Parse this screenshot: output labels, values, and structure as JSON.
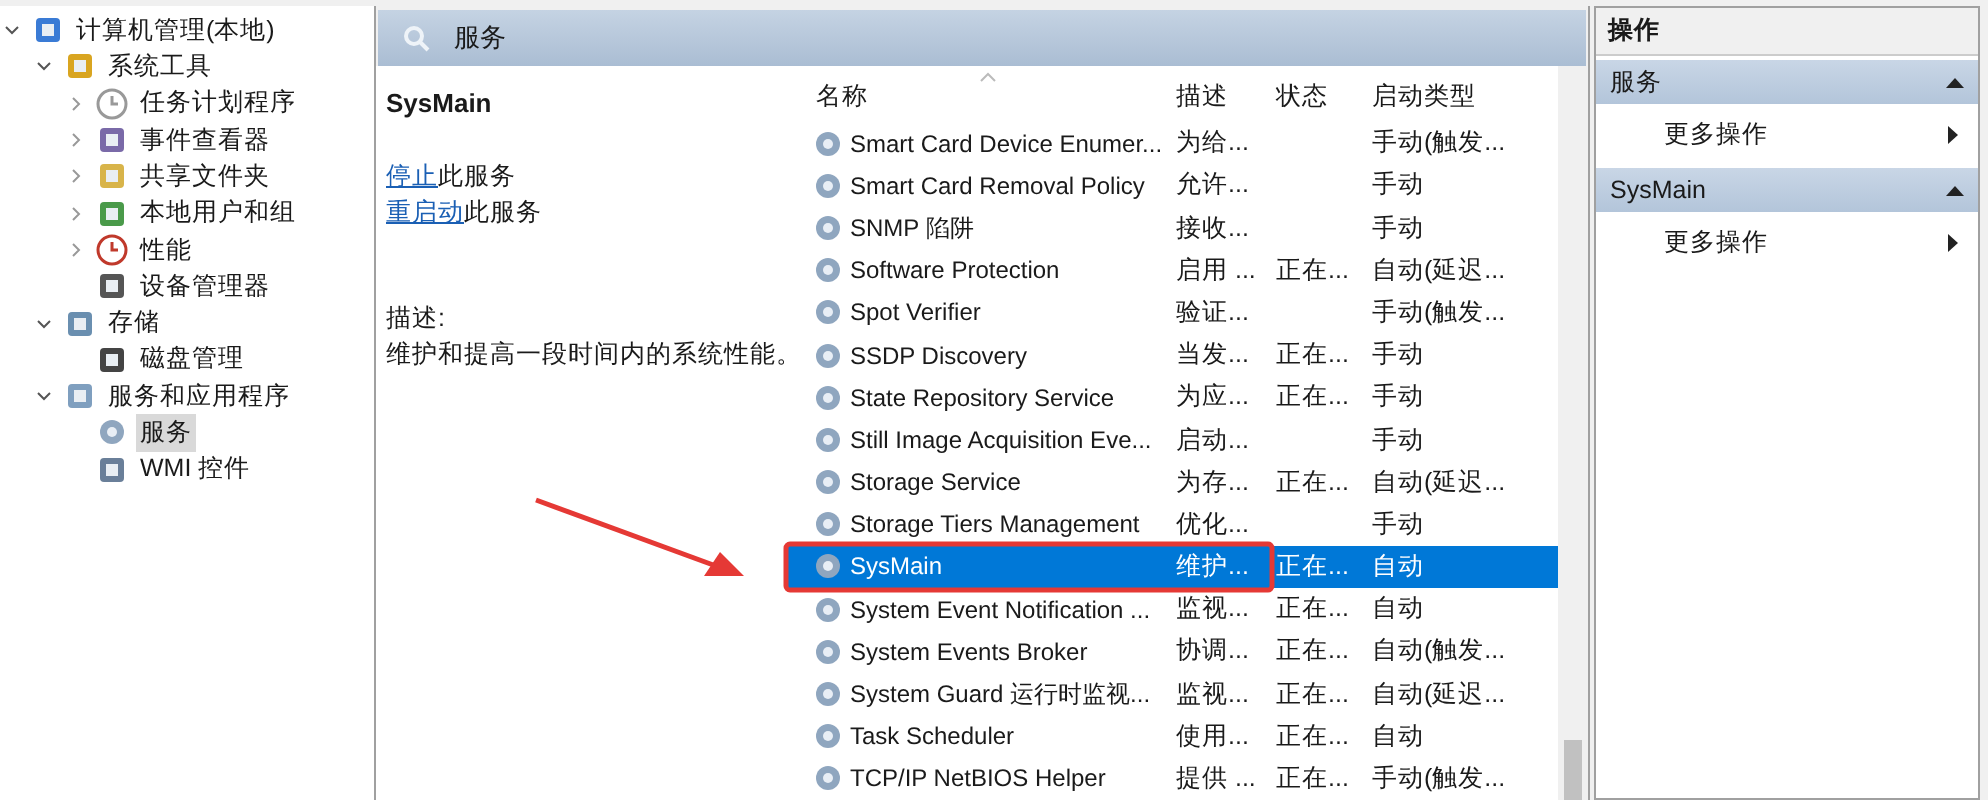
{
  "tree": [
    {
      "label": "计算机管理(本地)",
      "selected": false,
      "expanded": true,
      "children": [
        {
          "label": "系统工具",
          "selected": false,
          "expanded": true,
          "children": [
            {
              "label": "任务计划程序",
              "selected": false,
              "expanded": false
            },
            {
              "label": "事件查看器",
              "selected": false,
              "expanded": false
            },
            {
              "label": "共享文件夹",
              "selected": false,
              "expanded": false
            },
            {
              "label": "本地用户和组",
              "selected": false,
              "expanded": false
            },
            {
              "label": "性能",
              "selected": false,
              "expanded": false
            },
            {
              "label": "设备管理器",
              "selected": false
            }
          ]
        },
        {
          "label": "存储",
          "selected": false,
          "expanded": true,
          "children": [
            {
              "label": "磁盘管理",
              "selected": false
            }
          ]
        },
        {
          "label": "服务和应用程序",
          "selected": false,
          "expanded": true,
          "children": [
            {
              "label": "服务",
              "selected": true
            },
            {
              "label": "WMI 控件",
              "selected": false
            }
          ]
        }
      ]
    }
  ],
  "panel_title": "服务",
  "detail": {
    "service_name": "SysMain",
    "actions": [
      {
        "link": "停止",
        "text": "此服务"
      },
      {
        "link": "重启动",
        "text": "此服务"
      }
    ],
    "description_label": "描述:",
    "description": "维护和提高一段时间内的系统性能。"
  },
  "table": {
    "columns": [
      "名称",
      "描述",
      "状态",
      "启动类型"
    ],
    "rows": [
      {
        "name": "Smart Card Device Enumer...",
        "description": "为给...",
        "status": "",
        "startup": "手动(触发...",
        "selected": false
      },
      {
        "name": "Smart Card Removal Policy",
        "description": "允许...",
        "status": "",
        "startup": "手动",
        "selected": false
      },
      {
        "name": "SNMP 陷阱",
        "description": "接收...",
        "status": "",
        "startup": "手动",
        "selected": false
      },
      {
        "name": "Software Protection",
        "description": "启用 ...",
        "status": "正在...",
        "startup": "自动(延迟...",
        "selected": false
      },
      {
        "name": "Spot Verifier",
        "description": "验证...",
        "status": "",
        "startup": "手动(触发...",
        "selected": false
      },
      {
        "name": "SSDP Discovery",
        "description": "当发...",
        "status": "正在...",
        "startup": "手动",
        "selected": false
      },
      {
        "name": "State Repository Service",
        "description": "为应...",
        "status": "正在...",
        "startup": "手动",
        "selected": false
      },
      {
        "name": "Still Image Acquisition Eve...",
        "description": "启动...",
        "status": "",
        "startup": "手动",
        "selected": false
      },
      {
        "name": "Storage Service",
        "description": "为存...",
        "status": "正在...",
        "startup": "自动(延迟...",
        "selected": false
      },
      {
        "name": "Storage Tiers Management",
        "description": "优化...",
        "status": "",
        "startup": "手动",
        "selected": false
      },
      {
        "name": "SysMain",
        "description": "维护...",
        "status": "正在...",
        "startup": "自动",
        "selected": true
      },
      {
        "name": "System Event Notification ...",
        "description": "监视...",
        "status": "正在...",
        "startup": "自动",
        "selected": false
      },
      {
        "name": "System Events Broker",
        "description": "协调...",
        "status": "正在...",
        "startup": "自动(触发...",
        "selected": false
      },
      {
        "name": "System Guard 运行时监视...",
        "description": "监视...",
        "status": "正在...",
        "startup": "自动(延迟...",
        "selected": false
      },
      {
        "name": "Task Scheduler",
        "description": "使用...",
        "status": "正在...",
        "startup": "自动",
        "selected": false
      },
      {
        "name": "TCP/IP NetBIOS Helper",
        "description": "提供 ...",
        "status": "正在...",
        "startup": "手动(触发...",
        "selected": false
      }
    ]
  },
  "actions_pane": {
    "title": "操作",
    "sections": [
      {
        "title": "服务",
        "expanded": true,
        "items": [
          "更多操作"
        ]
      },
      {
        "title": "SysMain",
        "expanded": true,
        "items": [
          "更多操作"
        ]
      }
    ]
  }
}
